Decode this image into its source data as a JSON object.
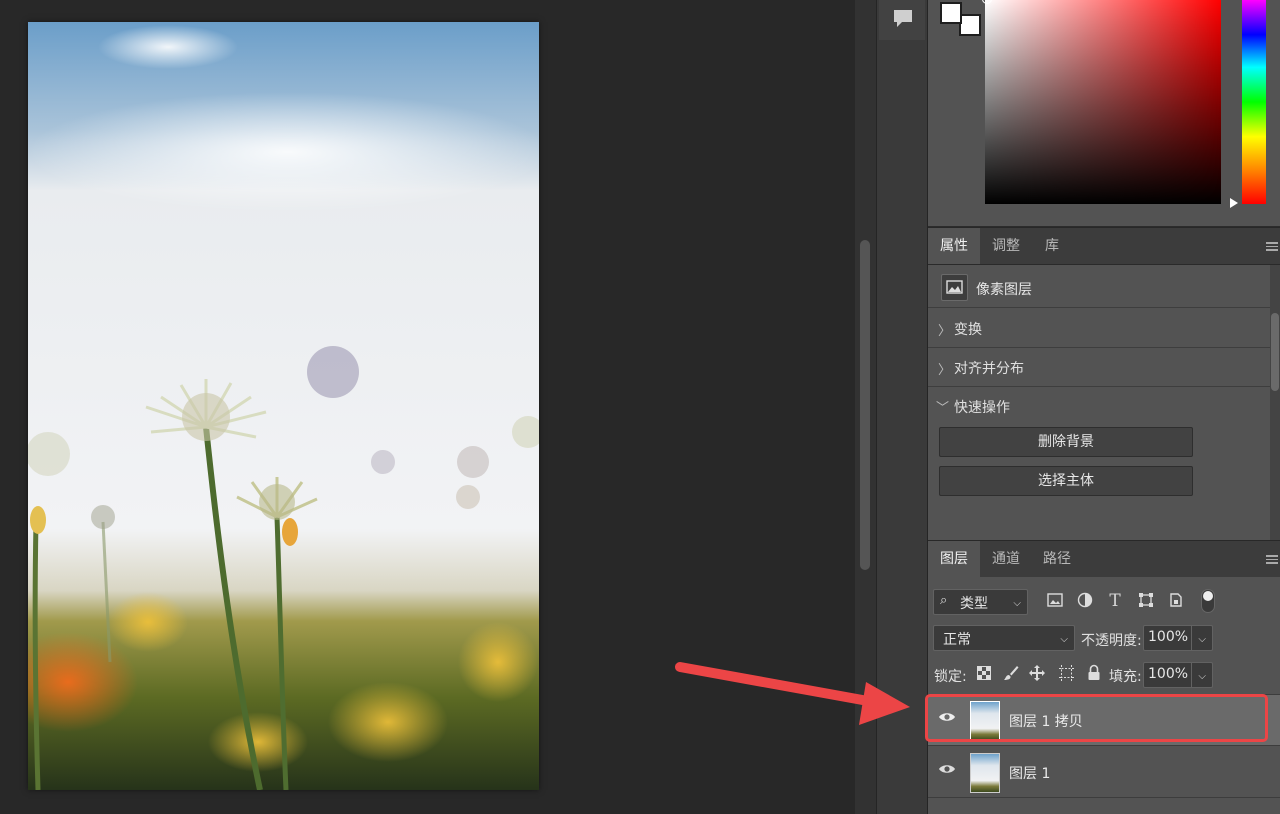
{
  "colors": {
    "canvas_bg": "#282828",
    "panel_bg": "#535353",
    "selected_layer_bg": "#6a6a6a",
    "annotation_red": "#ec4546",
    "foreground_swatch": "#ffffff",
    "background_swatch": "#ffffff"
  },
  "properties_panel": {
    "tabs": [
      {
        "label": "属性",
        "active": true
      },
      {
        "label": "调整",
        "active": false
      },
      {
        "label": "库",
        "active": false
      }
    ],
    "layer_kind": "像素图层",
    "sections": [
      {
        "label": "变换",
        "expanded": false
      },
      {
        "label": "对齐并分布",
        "expanded": false
      },
      {
        "label": "快速操作",
        "expanded": true
      }
    ],
    "quick_actions": [
      "删除背景",
      "选择主体"
    ]
  },
  "layers_panel": {
    "tabs": [
      {
        "label": "图层",
        "active": true
      },
      {
        "label": "通道",
        "active": false
      },
      {
        "label": "路径",
        "active": false
      }
    ],
    "filter": "类型",
    "filter_icons": [
      "image-filter-icon",
      "adjustment-filter-icon",
      "type-filter-icon",
      "shape-filter-icon",
      "smart-object-filter-icon"
    ],
    "blend_mode": "正常",
    "opacity_label": "不透明度:",
    "opacity_value": "100%",
    "lock_label": "锁定:",
    "fill_label": "填充:",
    "fill_value": "100%",
    "layers": [
      {
        "name": "图层 1 拷贝",
        "visible": true,
        "selected": true
      },
      {
        "name": "图层 1",
        "visible": true,
        "selected": false
      }
    ]
  }
}
